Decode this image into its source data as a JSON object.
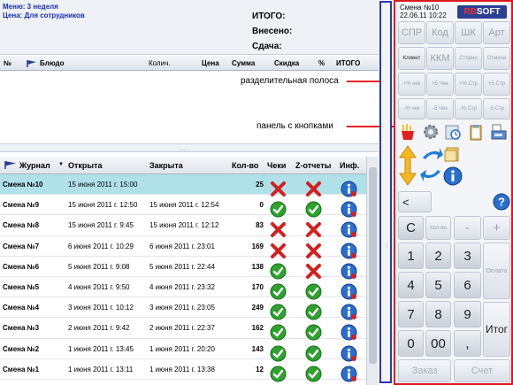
{
  "header": {
    "menu_line": "Меню: 3 неделя",
    "price_line": "Цена: Для сотрудников",
    "total_label": "ИТОГО:",
    "paid_label": "Внесено:",
    "change_label": "Сдача:"
  },
  "order_table": {
    "columns": [
      "№",
      "Блюдо",
      "Колич.",
      "Цена",
      "Сумма",
      "Скидка",
      "%",
      "ИТОГО"
    ]
  },
  "annotations": {
    "splitter": "разделительная полоса",
    "buttons_panel": "панель с кнопками"
  },
  "journal": {
    "columns": [
      "Журнал",
      "Открыта",
      "Закрыта",
      "Кол-во",
      "Чеки",
      "Z-отчеты",
      "Инф."
    ],
    "rows": [
      {
        "name": "Смена №10",
        "opened": "15 июня 2011 г. 15:00",
        "closed": "",
        "count": "25",
        "checks": "error",
        "z": "error",
        "selected": true
      },
      {
        "name": "Смена №9",
        "opened": "15 июня 2011 г. 12:50",
        "closed": "15 июня 2011 г. 12:54",
        "count": "0",
        "checks": "ok",
        "z": "ok",
        "selected": false
      },
      {
        "name": "Смена №8",
        "opened": "15 июня 2011 г. 9:45",
        "closed": "15 июня 2011 г. 12:12",
        "count": "83",
        "checks": "error",
        "z": "error",
        "selected": false
      },
      {
        "name": "Смена №7",
        "opened": "6 июня 2011 г. 10:29",
        "closed": "6 июня 2011 г. 23:01",
        "count": "169",
        "checks": "error",
        "z": "error",
        "selected": false
      },
      {
        "name": "Смена №6",
        "opened": "5 июня 2011 г. 9:08",
        "closed": "5 июня 2011 г. 22:44",
        "count": "138",
        "checks": "ok",
        "z": "error",
        "selected": false
      },
      {
        "name": "Смена №5",
        "opened": "4 июня 2011 г. 9:50",
        "closed": "4 июня 2011 г. 23:32",
        "count": "170",
        "checks": "ok",
        "z": "ok",
        "selected": false
      },
      {
        "name": "Смена №4",
        "opened": "3 июня 2011 г. 10:12",
        "closed": "3 июня 2011 г. 23:05",
        "count": "249",
        "checks": "ok",
        "z": "ok",
        "selected": false
      },
      {
        "name": "Смена №3",
        "opened": "2 июня 2011 г. 9:42",
        "closed": "2 июня 2011 г. 22:37",
        "count": "162",
        "checks": "ok",
        "z": "ok",
        "selected": false
      },
      {
        "name": "Смена №2",
        "opened": "1 июня 2011 г. 13:45",
        "closed": "1 июня 2011 г. 20:20",
        "count": "143",
        "checks": "ok",
        "z": "ok",
        "selected": false
      },
      {
        "name": "Смена №1",
        "opened": "1 июня 2011 г. 13:11",
        "closed": "1 июня 2011 г. 13:38",
        "count": "12",
        "checks": "ok",
        "z": "ok",
        "selected": false
      }
    ]
  },
  "side": {
    "shift": "Смена №10",
    "datetime": "22.06.11 10:22",
    "logo_a": "RB",
    "logo_b": "SOFT",
    "row1": [
      "СПР",
      "Код",
      "ШК",
      "Арт"
    ],
    "row2": [
      "Клиент",
      "ККМ",
      "Сторно",
      "Отмена"
    ],
    "row3": [
      "+% чек",
      "+5 Чек",
      "+% Стр",
      "+5 Стр"
    ],
    "row4": [
      "-% чек",
      "-5 Чек",
      "-% Стр",
      "-5 Стр"
    ],
    "back": "<",
    "help": "?",
    "clear": "C",
    "qty": "Кол-во",
    "minus": "-",
    "plus": "+",
    "keys": [
      "1",
      "2",
      "3",
      "4",
      "5",
      "6",
      "7",
      "8",
      "9",
      "0",
      "00",
      ","
    ],
    "payment": "Оплата",
    "total": "Итог",
    "order": "Заказ",
    "bill": "Счет"
  },
  "colors": {
    "selected_row": "#b0e0e8",
    "blue_frame": "#2a36b4",
    "red_frame": "#e0171c",
    "menu_text": "#1a2fb0"
  }
}
